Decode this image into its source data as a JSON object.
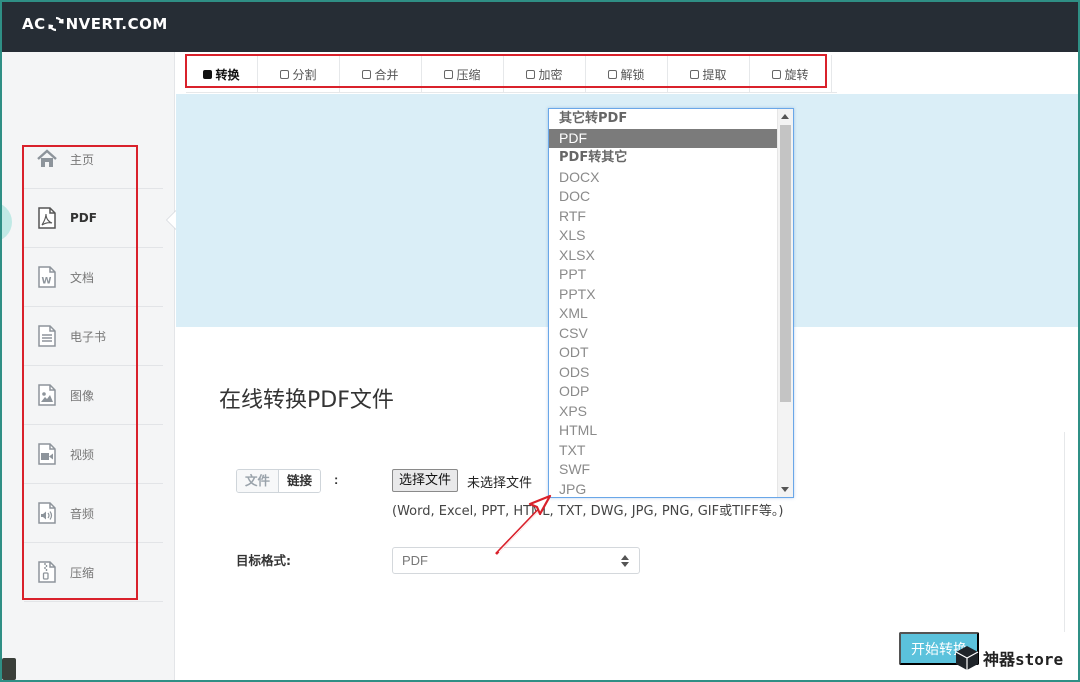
{
  "header": {
    "logo_left": "AC",
    "logo_right": "NVERT.COM"
  },
  "sidebar": {
    "items": [
      {
        "label": "主页",
        "icon": "home-icon"
      },
      {
        "label": "PDF",
        "icon": "pdf-file-icon"
      },
      {
        "label": "文档",
        "icon": "word-document-icon"
      },
      {
        "label": "电子书",
        "icon": "ebook-icon"
      },
      {
        "label": "图像",
        "icon": "image-icon"
      },
      {
        "label": "视频",
        "icon": "video-icon"
      },
      {
        "label": "音频",
        "icon": "audio-icon"
      },
      {
        "label": "压缩",
        "icon": "archive-icon"
      }
    ],
    "active": "PDF"
  },
  "tabs": [
    {
      "label": "转换",
      "active": true
    },
    {
      "label": "分割"
    },
    {
      "label": "合并"
    },
    {
      "label": "压缩"
    },
    {
      "label": "加密"
    },
    {
      "label": "解锁"
    },
    {
      "label": "提取"
    },
    {
      "label": "旋转"
    }
  ],
  "main": {
    "title": "在线转换PDF文件",
    "source_tabs": [
      "文件",
      "链接"
    ],
    "colon": ":",
    "choose_file_label": "选择文件",
    "no_file_label": "未选择文件",
    "formats_hint": "(Word, Excel, PPT, HTML, TXT, DWG, JPG, PNG, GIF或TIFF等。)",
    "target_label": "目标格式:",
    "target_value": "PDF",
    "start_button": "开始转换"
  },
  "dropdown": {
    "options": [
      {
        "label": "其它转PDF",
        "group": true
      },
      {
        "label": "PDF",
        "selected": true
      },
      {
        "label": "PDF转其它",
        "group": true
      },
      {
        "label": "DOCX"
      },
      {
        "label": "DOC"
      },
      {
        "label": "RTF"
      },
      {
        "label": "XLS"
      },
      {
        "label": "XLSX"
      },
      {
        "label": "PPT"
      },
      {
        "label": "PPTX"
      },
      {
        "label": "XML"
      },
      {
        "label": "CSV"
      },
      {
        "label": "ODT"
      },
      {
        "label": "ODS"
      },
      {
        "label": "ODP"
      },
      {
        "label": "XPS"
      },
      {
        "label": "HTML"
      },
      {
        "label": "TXT"
      },
      {
        "label": "SWF"
      },
      {
        "label": "JPG"
      }
    ]
  },
  "watermark": {
    "text": "神器store"
  },
  "colors": {
    "header_bg": "#262d35",
    "hero_bg": "#daeef7",
    "accent": "#5bc2dc",
    "annotation_red": "#d9212b",
    "selected_option_bg": "#7b7b7b"
  }
}
